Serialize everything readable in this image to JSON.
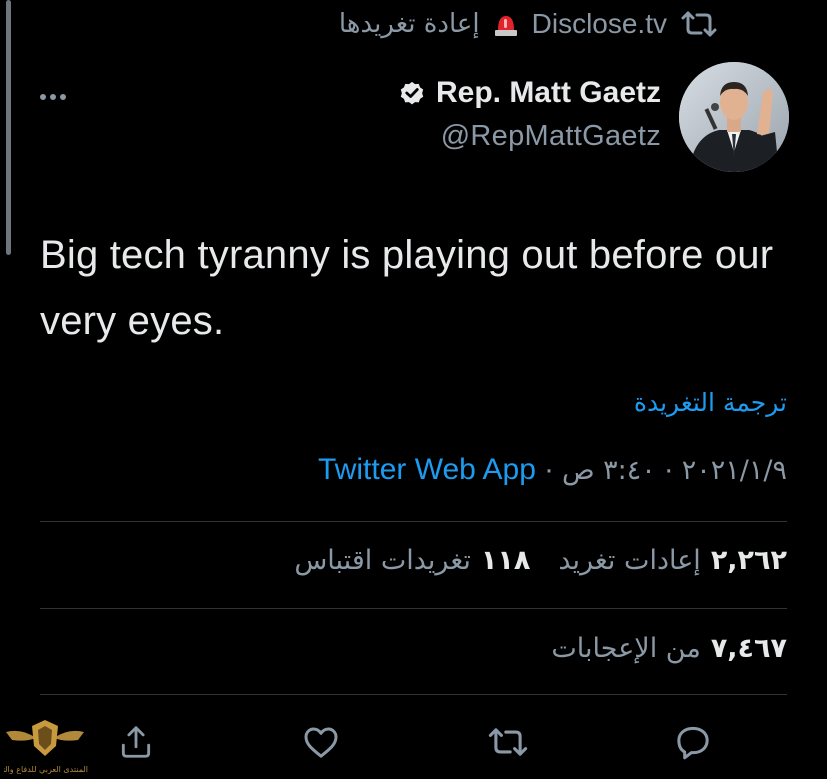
{
  "retweet_banner": {
    "account": "Disclose.tv",
    "action_label": "إعادة تغريدها"
  },
  "author": {
    "display_name": "Rep. Matt Gaetz",
    "handle": "@RepMattGaetz"
  },
  "tweet": {
    "text": "Big tech tyranny is playing out before our very eyes.",
    "translate_label": "ترجمة التغريدة",
    "time": "٣:٤٠ ص",
    "date": "٢٠٢١/١/٩",
    "separator": "·",
    "source_app": "Twitter Web App"
  },
  "stats": {
    "retweets_count": "٢,٢٦٢",
    "retweets_label": "إعادات تغريد",
    "quotes_count": "١١٨",
    "quotes_label": "تغريدات اقتباس",
    "likes_count": "٧,٤٦٧",
    "likes_label": "من الإعجابات"
  },
  "icons": {
    "retweet": "retweet-icon",
    "siren": "siren-icon",
    "verified": "verified-badge-icon",
    "more": "more-options-icon",
    "reply": "reply-icon",
    "like": "like-icon",
    "share": "share-icon"
  },
  "watermark": {
    "text": "المنتدى العربي للدفاع والتسليح"
  },
  "colors": {
    "background": "#000000",
    "primary_text": "#e7e9ea",
    "secondary_text": "#8b98a5",
    "link": "#1d9bf0",
    "divider": "#2f3336"
  }
}
